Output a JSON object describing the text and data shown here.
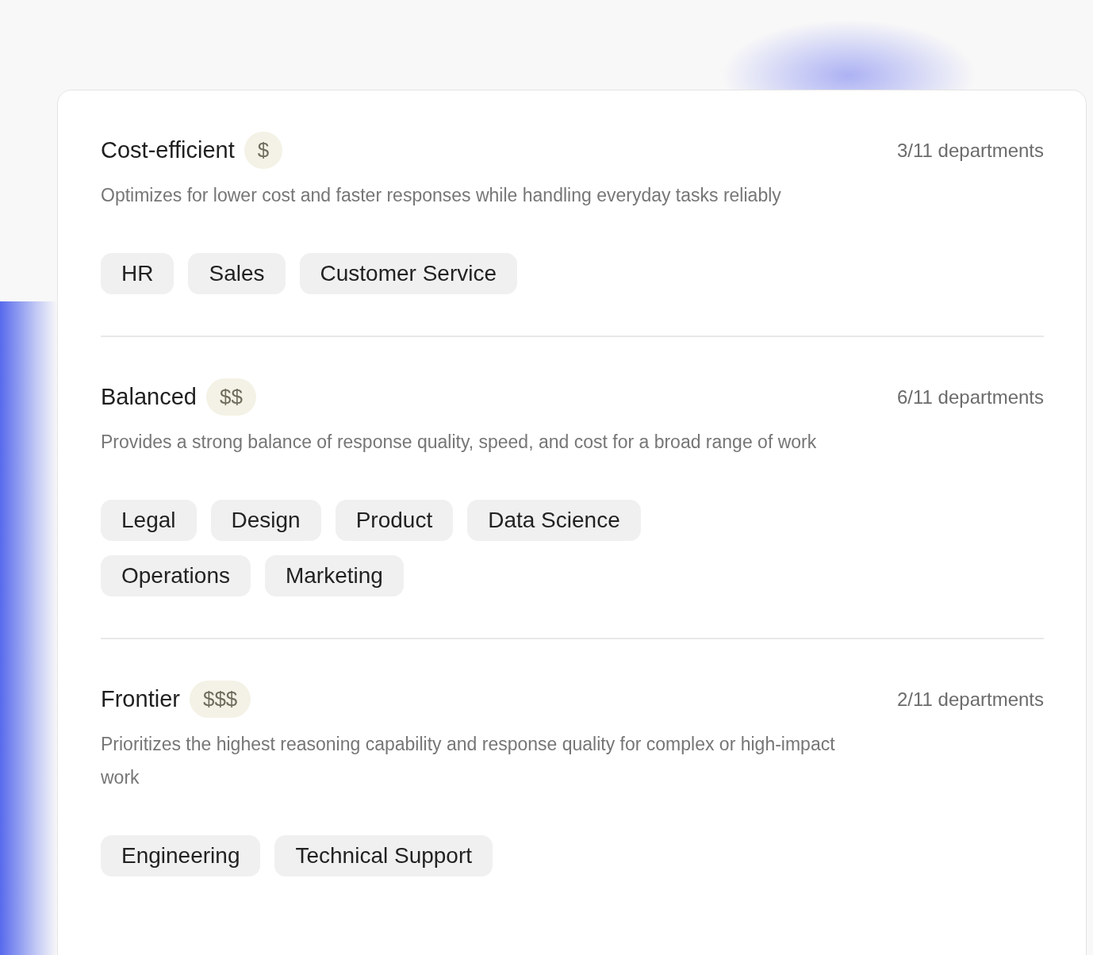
{
  "tiers": [
    {
      "name": "Cost-efficient",
      "price": "$",
      "count": "3/11 departments",
      "description": "Optimizes for lower cost and faster responses while handling everyday tasks reliably",
      "departments": [
        "HR",
        "Sales",
        "Customer Service"
      ]
    },
    {
      "name": "Balanced",
      "price": "$$",
      "count": "6/11 departments",
      "description": "Provides a strong balance of response quality, speed, and cost for a broad range of work",
      "departments": [
        "Legal",
        "Design",
        "Product",
        "Data Science",
        "Operations",
        "Marketing"
      ]
    },
    {
      "name": "Frontier",
      "price": "$$$",
      "count": "2/11 departments",
      "description": "Prioritizes the highest reasoning capability and response quality for complex or high-impact work",
      "departments": [
        "Engineering",
        "Technical Support"
      ]
    }
  ]
}
